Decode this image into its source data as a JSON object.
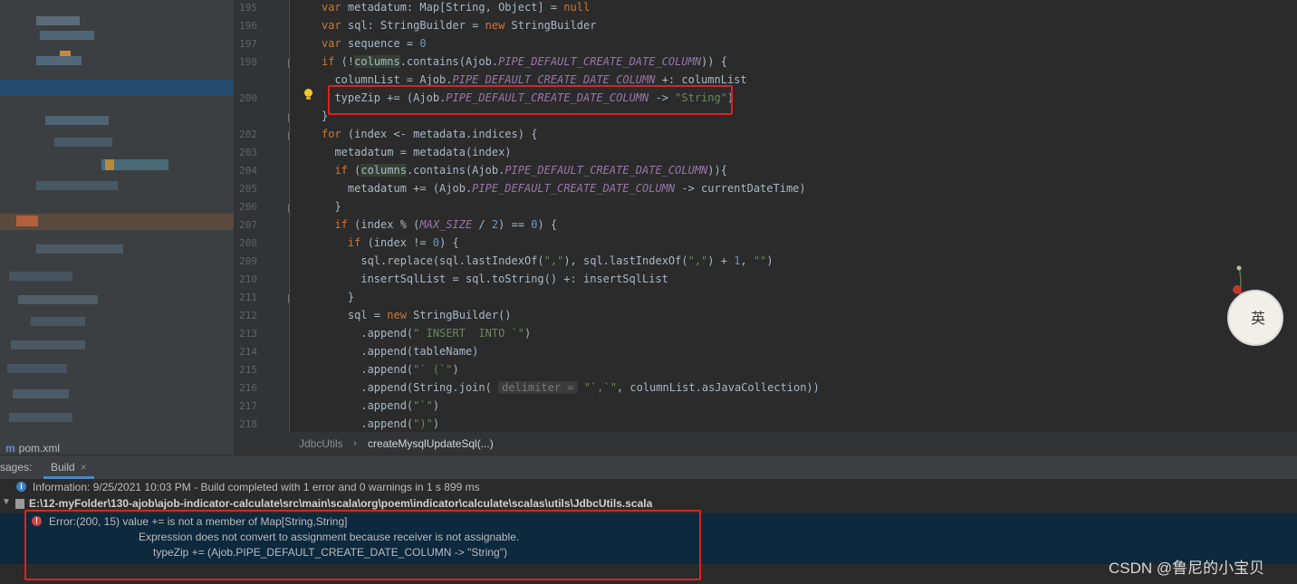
{
  "project_panel": {
    "pom_label": "pom.xml",
    "pom_icon": "maven-module-icon"
  },
  "editor": {
    "line_numbers": [
      "195",
      "196",
      "197",
      "198",
      "",
      "200",
      "",
      "202",
      "203",
      "204",
      "205",
      "206",
      "207",
      "208",
      "209",
      "210",
      "211",
      "212",
      "213",
      "214",
      "215",
      "216",
      "217",
      "218"
    ],
    "lines": [
      "var metadatum: Map[String, Object] = null",
      "var sql: StringBuilder = new StringBuilder",
      "var sequence = 0",
      "if (!columns.contains(Ajob.PIPE_DEFAULT_CREATE_DATE_COLUMN)) {",
      "  columnList = Ajob.PIPE_DEFAULT_CREATE_DATE_COLUMN +: columnList",
      "  typeZip += (Ajob.PIPE_DEFAULT_CREATE_DATE_COLUMN -> \"String\")",
      "}",
      "for (index <- metadata.indices) {",
      "  metadatum = metadata(index)",
      "  if (columns.contains(Ajob.PIPE_DEFAULT_CREATE_DATE_COLUMN)){",
      "    metadatum += (Ajob.PIPE_DEFAULT_CREATE_DATE_COLUMN -> currentDateTime)",
      "  }",
      "  if (index % (MAX_SIZE / 2) == 0) {",
      "    if (index != 0) {",
      "      sql.replace(sql.lastIndexOf(\",\"), sql.lastIndexOf(\",\") + 1, \"\")",
      "      insertSqlList = sql.toString() +: insertSqlList",
      "    }",
      "    sql = new StringBuilder()",
      "      .append(\" INSERT  INTO `\")",
      "      .append(tableName)",
      "      .append(\"` (`\")",
      "      .append(String.join( delimiter = \"`,`\", columnList.asJavaCollection))",
      "      .append(\"`\")",
      "      .append(\")\")"
    ]
  },
  "breadcrumb": {
    "file": "JdbcUtils",
    "separator": "›",
    "method": "createMysqlUpdateSql(...)"
  },
  "tool_window": {
    "messages_label": "sages:",
    "build_tab": "Build",
    "close_glyph": "×",
    "info_text": "Information: 9/25/2021 10:03 PM - Build completed with 1 error and 0 warnings in 1 s 899 ms",
    "path_text": "E:\\12-myFolder\\130-ajob\\ajob-indicator-calculate\\src\\main\\scala\\org\\poem\\indicator\\calculate\\scalas\\utils\\JdbcUtils.scala",
    "error_line1": "Error:(200, 15)  value += is not a member of Map[String,String]",
    "error_line2": "Expression does not convert to assignment because receiver is not assignable.",
    "error_line3": "typeZip += (Ajob.PIPE_DEFAULT_CREATE_DATE_COLUMN -> \"String\")"
  },
  "avatar": {
    "char": "英"
  },
  "watermark": "CSDN @鲁尼的小宝贝",
  "colors": {
    "editor_bg": "#2b2b2b",
    "error_bg": "#0d293e",
    "highlight_box": "#e02020",
    "keyword": "#cc7832",
    "constant": "#9876aa",
    "string": "#6a8759"
  }
}
